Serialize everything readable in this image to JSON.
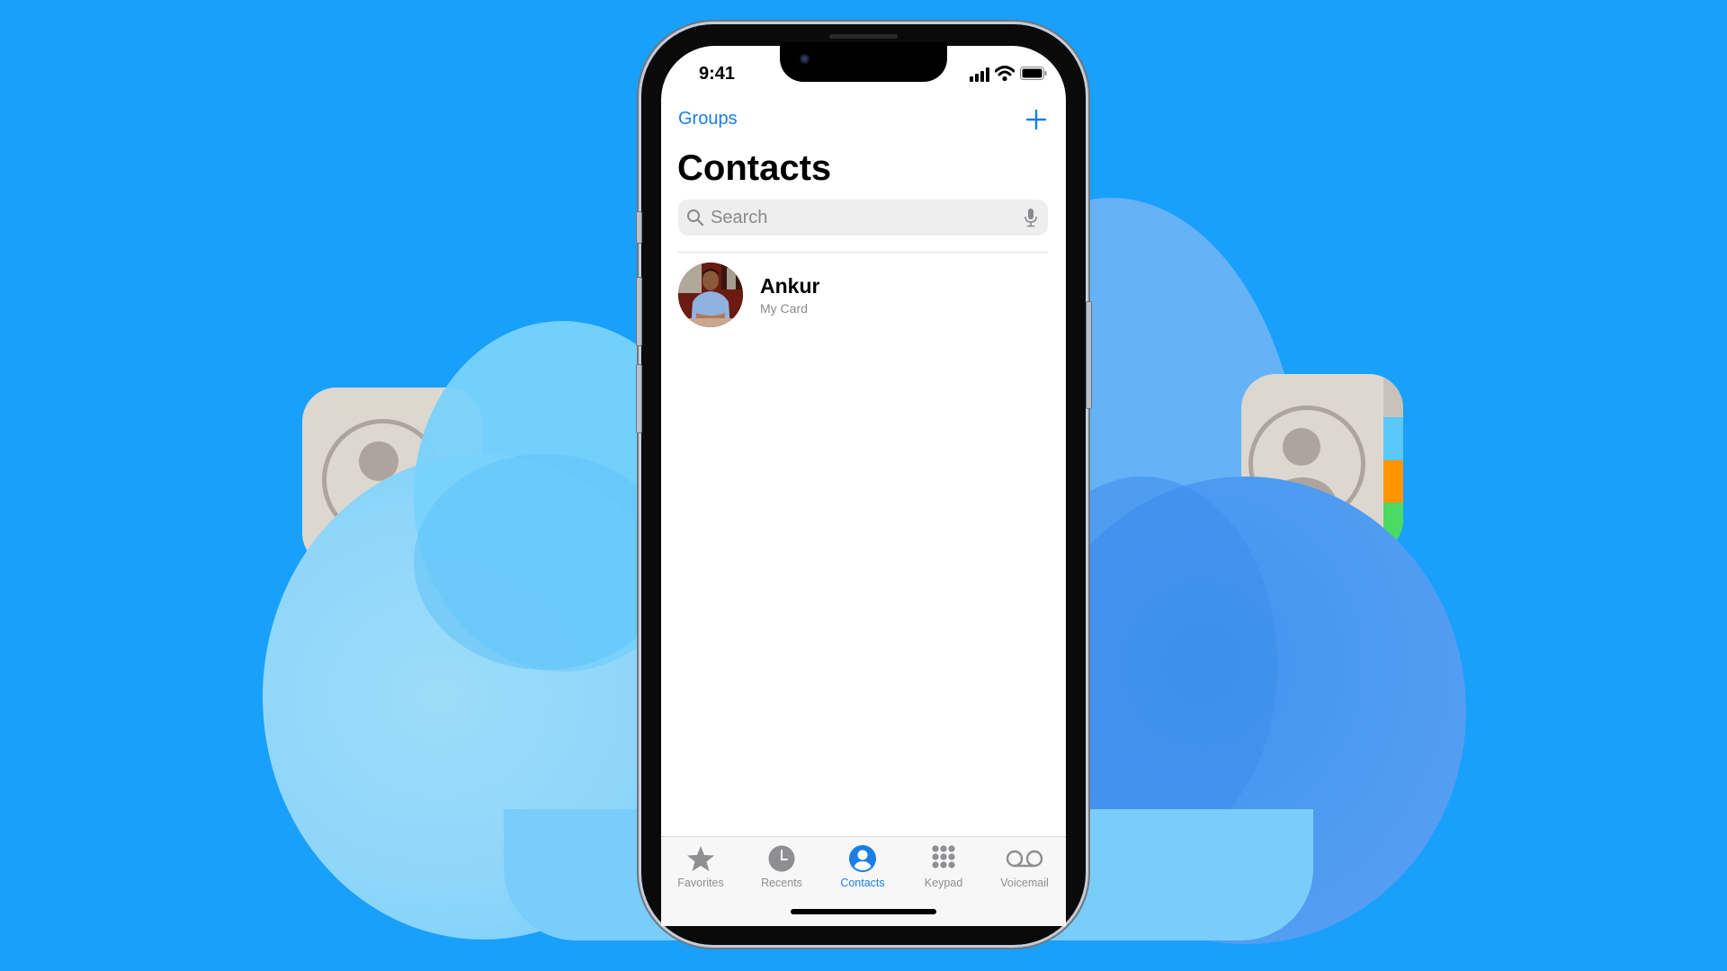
{
  "background": {
    "color": "#18a0fb",
    "decorations": [
      "cloud-shapes",
      "contacts-app-icon-left",
      "contacts-app-icon-right"
    ]
  },
  "status_bar": {
    "time": "9:41",
    "icons": [
      "cellular-signal-icon",
      "wifi-icon",
      "battery-icon"
    ]
  },
  "nav": {
    "left_button": "Groups",
    "right_button_icon": "plus-icon",
    "accent_color": "#1a7ee6"
  },
  "page": {
    "title": "Contacts"
  },
  "search": {
    "placeholder": "Search",
    "value": "",
    "icon": "search-icon",
    "trailing_icon": "microphone-icon"
  },
  "contacts": [
    {
      "name": "Ankur",
      "subtitle": "My Card",
      "avatar": "photo"
    }
  ],
  "tab_bar": {
    "active": "Contacts",
    "tabs": [
      {
        "label": "Favorites",
        "icon": "star-icon"
      },
      {
        "label": "Recents",
        "icon": "clock-icon"
      },
      {
        "label": "Contacts",
        "icon": "person-circle-icon"
      },
      {
        "label": "Keypad",
        "icon": "keypad-icon"
      },
      {
        "label": "Voicemail",
        "icon": "voicemail-icon"
      }
    ]
  }
}
